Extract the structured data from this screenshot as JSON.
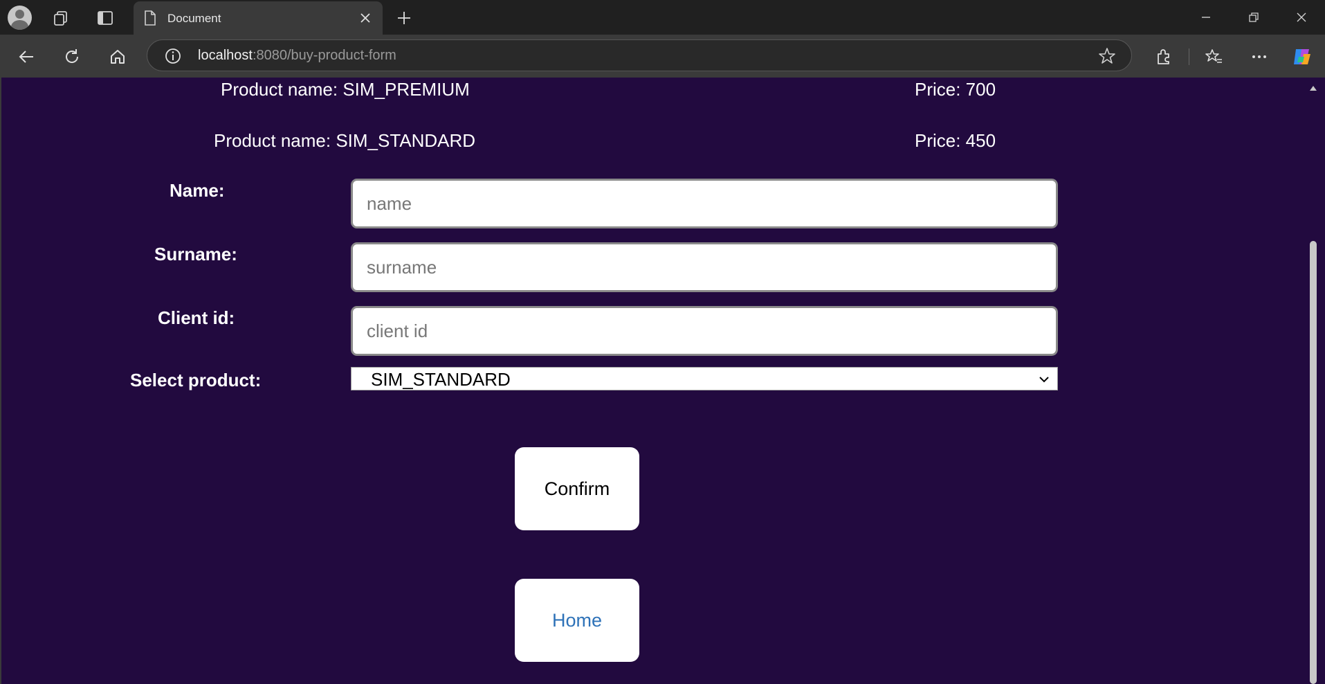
{
  "browser": {
    "tab_title": "Document",
    "url_host": "localhost",
    "url_rest": ":8080/buy-product-form"
  },
  "products": [
    {
      "name_text": "Product name: SIM_PREMIUM",
      "price_text": "Price: 700"
    },
    {
      "name_text": "Product name: SIM_STANDARD",
      "price_text": "Price: 450"
    }
  ],
  "form": {
    "name_label": "Name:",
    "name_placeholder": "name",
    "surname_label": "Surname:",
    "surname_placeholder": "surname",
    "client_id_label": "Client id:",
    "client_id_placeholder": "client id",
    "select_label": "Select product:",
    "select_value": "SIM_STANDARD",
    "confirm_label": "Confirm",
    "home_label": "Home"
  },
  "colors": {
    "page_background": "#220a3f",
    "link": "#2e72b8"
  }
}
